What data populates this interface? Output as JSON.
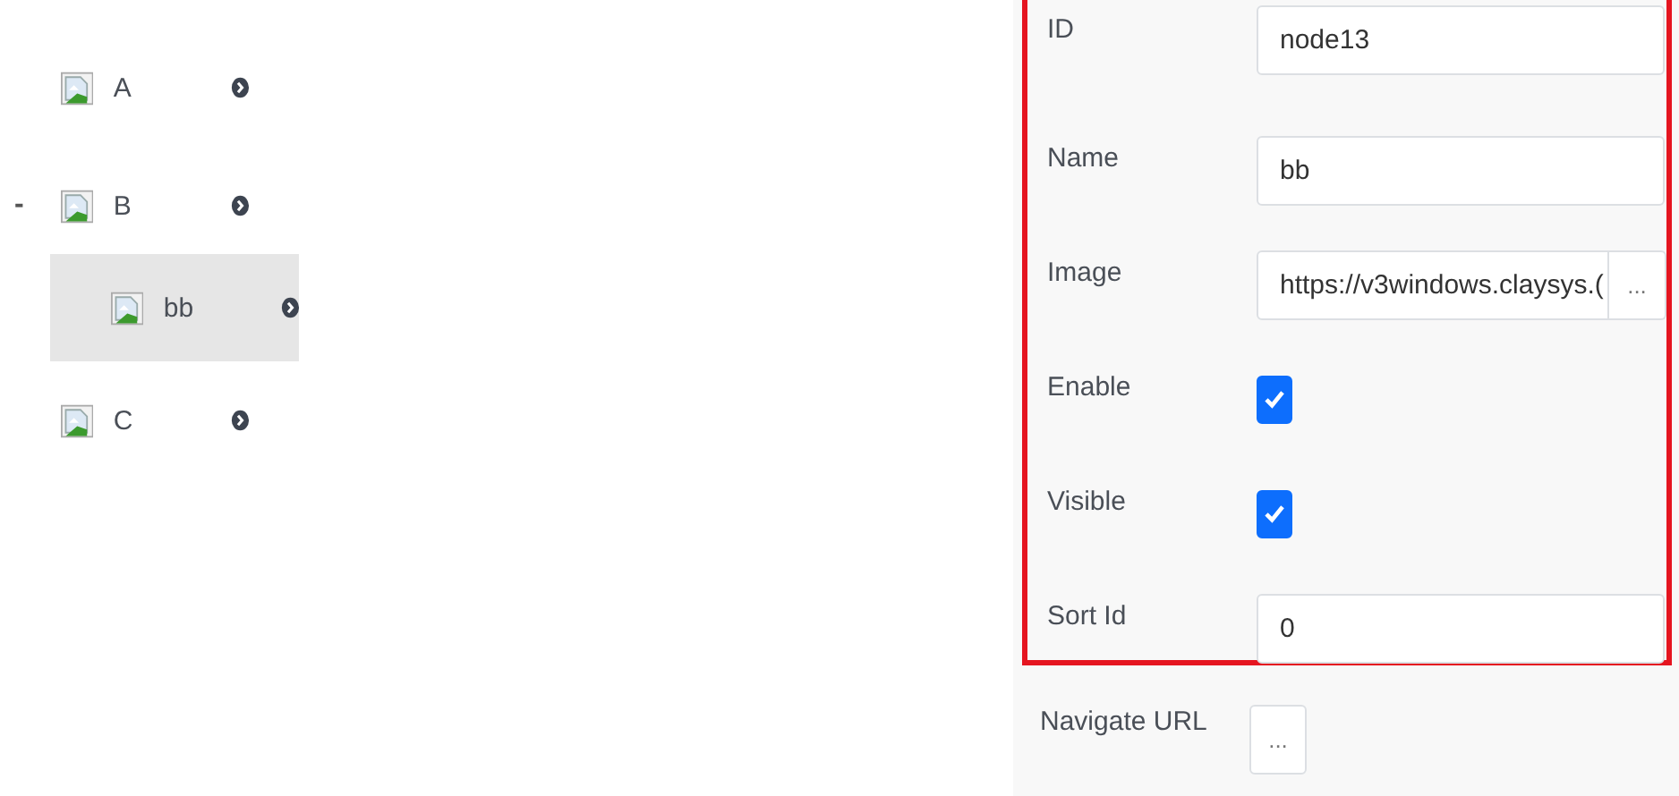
{
  "tree": [
    {
      "label": "A",
      "selected": false
    },
    {
      "label": "B",
      "toggle": "-",
      "expanded": true,
      "selected": false,
      "children": [
        {
          "label": "bb",
          "selected": true
        }
      ]
    },
    {
      "label": "C",
      "selected": false
    }
  ],
  "properties": {
    "highlighted_fields": [
      {
        "label": "ID",
        "kind": "text",
        "value": "node13"
      },
      {
        "label": "Name",
        "kind": "text",
        "value": "bb"
      },
      {
        "label": "Image",
        "kind": "browse",
        "value": "https://v3windows.claysys.(",
        "button": "..."
      },
      {
        "label": "Enable",
        "kind": "checkbox",
        "checked": true
      },
      {
        "label": "Visible",
        "kind": "checkbox",
        "checked": true
      },
      {
        "label": "Sort Id",
        "kind": "text",
        "value": "0"
      }
    ],
    "fields": [
      {
        "label": "Navigate URL",
        "kind": "button",
        "button": "..."
      }
    ]
  }
}
